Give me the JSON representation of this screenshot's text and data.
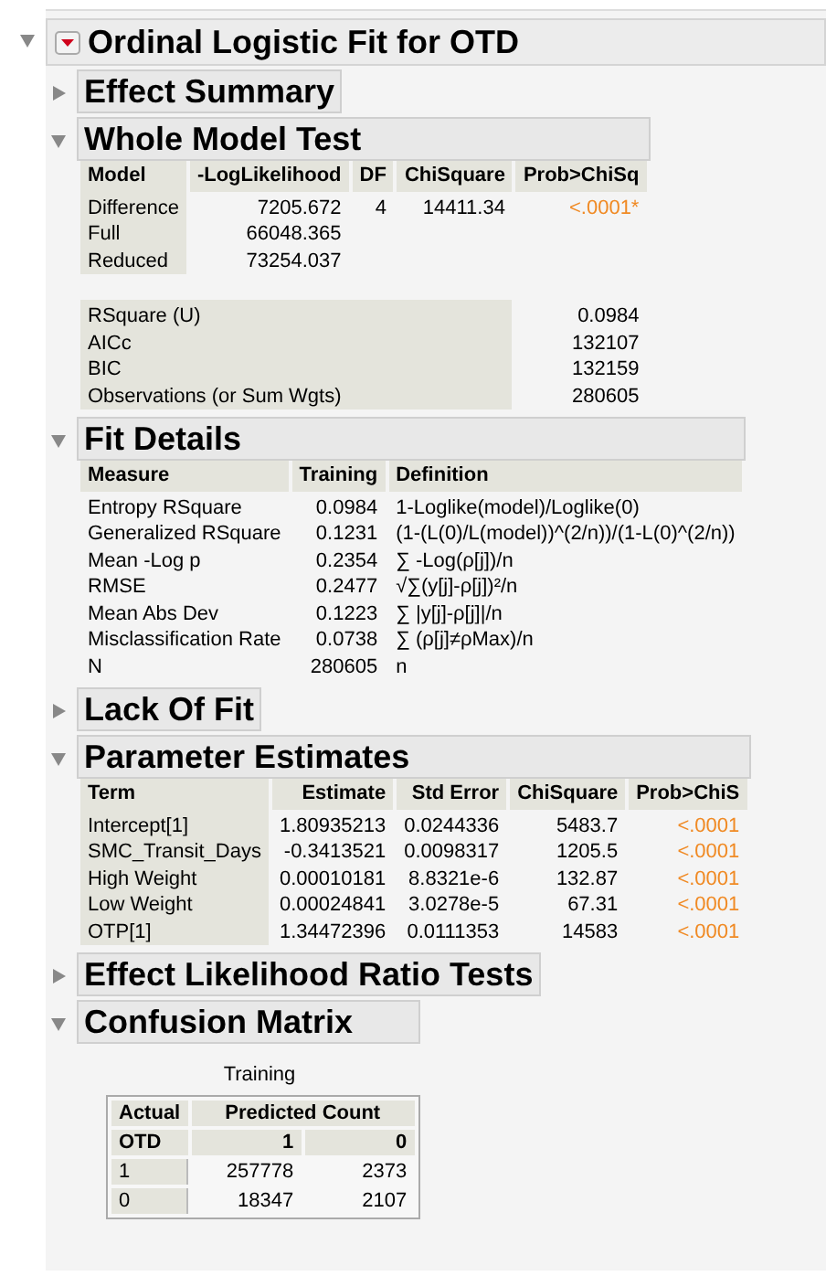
{
  "report": {
    "title": "Ordinal Logistic Fit for OTD",
    "expanded": true,
    "sections": [
      {
        "title": "Effect Summary",
        "expanded": false
      },
      {
        "title": "Whole Model Test",
        "expanded": true,
        "tables": [
          {
            "kind": "shaded",
            "columns": [
              "Model",
              "-LogLikelihood",
              "DF",
              "ChiSquare",
              "Prob>ChiSq"
            ],
            "rows": [
              {
                "cells": [
                  "Difference",
                  "7205.672",
                  "4",
                  "14411.34",
                  "<.0001*"
                ],
                "significant": true
              },
              {
                "cells": [
                  "Full",
                  "66048.365"
                ]
              },
              {
                "cells": [
                  "Reduced",
                  "73254.037"
                ]
              }
            ]
          },
          {
            "kind": "shaded",
            "rows": [
              {
                "cells": [
                  "RSquare (U)",
                  "0.0984"
                ]
              },
              {
                "cells": [
                  "AICc",
                  "132107"
                ]
              },
              {
                "cells": [
                  "BIC",
                  "132159"
                ]
              },
              {
                "cells": [
                  "Observations (or Sum Wgts)",
                  "280605"
                ]
              }
            ]
          }
        ]
      },
      {
        "title": "Fit Details",
        "expanded": true,
        "tables": [
          {
            "kind": "plain",
            "columns": [
              "Measure",
              "Training",
              "Definition"
            ],
            "rows": [
              {
                "cells": [
                  "Entropy RSquare",
                  "0.0984",
                  "1-Loglike(model)/Loglike(0)"
                ]
              },
              {
                "cells": [
                  "Generalized RSquare",
                  "0.1231",
                  "(1-(L(0)/L(model))^(2/n))/(1-L(0)^(2/n))"
                ]
              },
              {
                "cells": [
                  "Mean -Log p",
                  "0.2354",
                  "∑ -Log(ρ[j])/n"
                ]
              },
              {
                "cells": [
                  "RMSE",
                  "0.2477",
                  "√∑(y[j]-ρ[j])²/n"
                ]
              },
              {
                "cells": [
                  "Mean Abs Dev",
                  "0.1223",
                  "∑ |y[j]-ρ[j]|/n"
                ]
              },
              {
                "cells": [
                  "Misclassification Rate",
                  "0.0738",
                  "∑ (ρ[j]≠ρMax)/n"
                ]
              },
              {
                "cells": [
                  "N",
                  "280605",
                  "n"
                ]
              }
            ]
          }
        ]
      },
      {
        "title": "Lack Of Fit",
        "expanded": false
      },
      {
        "title": "Parameter Estimates",
        "expanded": true,
        "tables": [
          {
            "kind": "shaded",
            "columns": [
              "Term",
              "Estimate",
              "Std Error",
              "ChiSquare",
              "Prob>ChiS"
            ],
            "rows": [
              {
                "cells": [
                  "Intercept[1]",
                  "1.80935213",
                  "0.0244336",
                  "5483.7",
                  "<.0001"
                ],
                "significant": true
              },
              {
                "cells": [
                  "SMC_Transit_Days",
                  "-0.3413521",
                  "0.0098317",
                  "1205.5",
                  "<.0001"
                ],
                "significant": true
              },
              {
                "cells": [
                  "High Weight",
                  "0.00010181",
                  "8.8321e-6",
                  "132.87",
                  "<.0001"
                ],
                "significant": true
              },
              {
                "cells": [
                  "Low Weight",
                  "0.00024841",
                  "3.0278e-5",
                  "67.31",
                  "<.0001"
                ],
                "significant": true
              },
              {
                "cells": [
                  "OTP[1]",
                  "1.34472396",
                  "0.0111353",
                  "14583",
                  "<.0001"
                ],
                "significant": true
              }
            ]
          }
        ]
      },
      {
        "title": "Effect Likelihood Ratio Tests",
        "expanded": false
      },
      {
        "title": "Confusion Matrix",
        "expanded": true,
        "matrix": {
          "caption": "Training",
          "corner": "Actual",
          "group": "Predicted Count",
          "row_header": "OTD",
          "columns": [
            "1",
            "0"
          ],
          "rows": [
            {
              "label": "1",
              "cells": [
                "257778",
                "2373"
              ]
            },
            {
              "label": "0",
              "cells": [
                "18347",
                "2107"
              ]
            }
          ]
        }
      }
    ]
  }
}
